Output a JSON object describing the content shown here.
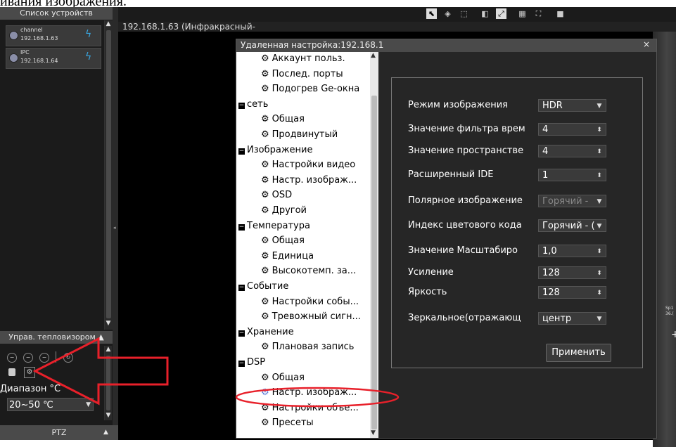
{
  "caption": "ивания изображения.",
  "left_panel": {
    "device_list_title": "Список устройств",
    "devices": [
      {
        "name": "channel",
        "ip": "192.168.1.63"
      },
      {
        "name": "IPC",
        "ip": "192.168.1.64"
      }
    ],
    "thermal_control_title": "Управ. тепловизором ▲",
    "range_label": "Диапазон °C",
    "range_value": "20~50 ℃",
    "ptz_title": "PTZ"
  },
  "video": {
    "tab_label": "192.168.1.63 (Инфракрасный-",
    "spot_label_1": "Sp1",
    "spot_label_2": "36.("
  },
  "dialog": {
    "title": "Удаленная настройка:192.168.1",
    "close": "×",
    "tree": [
      {
        "type": "leaf",
        "label": "Аккаунт польз."
      },
      {
        "type": "leaf",
        "label": "Послед. порты"
      },
      {
        "type": "leaf",
        "label": "Подогрев Ge-окна"
      },
      {
        "type": "node",
        "label": "сеть"
      },
      {
        "type": "leaf",
        "label": "Общая"
      },
      {
        "type": "leaf",
        "label": "Продвинутый"
      },
      {
        "type": "node",
        "label": "Изображение"
      },
      {
        "type": "leaf",
        "label": "Настройки видео"
      },
      {
        "type": "leaf",
        "label": "Настр. изображ..."
      },
      {
        "type": "leaf",
        "label": "OSD"
      },
      {
        "type": "leaf",
        "label": "Другой"
      },
      {
        "type": "node",
        "label": "Температура"
      },
      {
        "type": "leaf",
        "label": "Общая"
      },
      {
        "type": "leaf",
        "label": "Единица"
      },
      {
        "type": "leaf",
        "label": "Высокотемп. за..."
      },
      {
        "type": "node",
        "label": "Событие"
      },
      {
        "type": "leaf",
        "label": "Настройки собы..."
      },
      {
        "type": "leaf",
        "label": "Тревожный сигн..."
      },
      {
        "type": "node",
        "label": "Хранение"
      },
      {
        "type": "leaf",
        "label": "Плановая запись"
      },
      {
        "type": "node",
        "label": "DSP"
      },
      {
        "type": "leaf",
        "label": "Общая"
      },
      {
        "type": "leaf",
        "label": "Настр. изображ...",
        "selected": true
      },
      {
        "type": "leaf",
        "label": "Настройки объе..."
      },
      {
        "type": "leaf",
        "label": "Пресеты"
      }
    ],
    "settings": [
      {
        "label": "Режим изображения",
        "value": "HDR",
        "kind": "select"
      },
      {
        "label": "Значение фильтра врем",
        "value": "4",
        "kind": "spin"
      },
      {
        "label": "Значение пространстве",
        "value": "4",
        "kind": "spin"
      },
      {
        "label": "Расширенный IDE",
        "value": "1",
        "kind": "spin"
      },
      {
        "label": "Полярное изображение",
        "value": "Горячий -",
        "kind": "select",
        "disabled": true
      },
      {
        "label": "Индекс цветового кода",
        "value": "Горячий - (",
        "kind": "select"
      },
      {
        "label": "Значение Масштабиро",
        "value": "1,0",
        "kind": "spin"
      },
      {
        "label": "Усиление",
        "value": "128",
        "kind": "spin"
      },
      {
        "label": "Яркость",
        "value": "128",
        "kind": "spin"
      },
      {
        "label": "Зеркальное(отражающ",
        "value": "центр",
        "kind": "select"
      }
    ],
    "apply_label": "Применить"
  },
  "colors": {
    "annotation_red": "#e8202a",
    "accent_blue": "#39a7e0"
  }
}
